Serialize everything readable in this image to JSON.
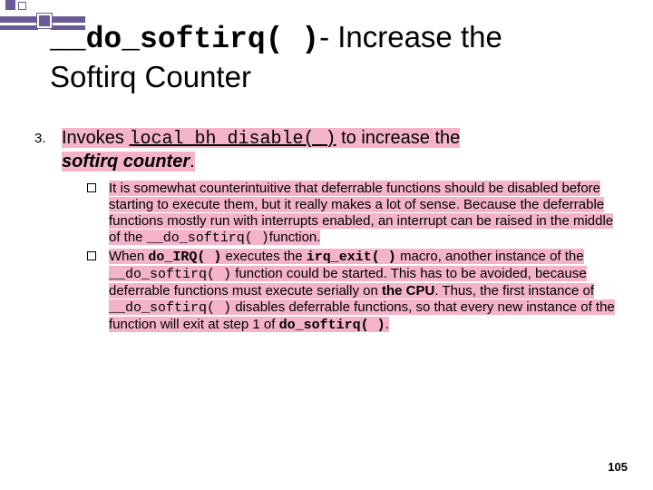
{
  "deco": {},
  "title": {
    "code": "__do_softirq( )",
    "rest1": "- Increase the",
    "line2": "Softirq Counter"
  },
  "item3": {
    "num": "3.",
    "t1": "Invokes ",
    "code": "local_bh_disable( )",
    "t2": " to increase the ",
    "bi": "softirq counter",
    "t3": "."
  },
  "sub1": {
    "p1": "It is somewhat counterintuitive that deferrable functions should be disabled before starting to execute them, but it really makes a lot of sense. Because the deferrable functions mostly run with interrupts enabled, an interrupt can be raised in the middle of the ",
    "c1": "__do_softirq( )",
    "p2": "function."
  },
  "sub2": {
    "p1": "When ",
    "c1": "do_IRQ( )",
    "p2": " executes the ",
    "c2": "irq_exit( )",
    "p3": " macro, another instance of the ",
    "c3": "__do_softirq( )",
    "p4": " function could be started. This has to be avoided, because deferrable functions must execute serially on ",
    "b1": "the CPU",
    "p5": ". Thus, the first instance of ",
    "c4": "__do_softirq( )",
    "p6": " disables deferrable functions, so that every new instance of the function will exit at step 1 of ",
    "c5": "do_softirq( )",
    "p7": "."
  },
  "pagenum": "105"
}
